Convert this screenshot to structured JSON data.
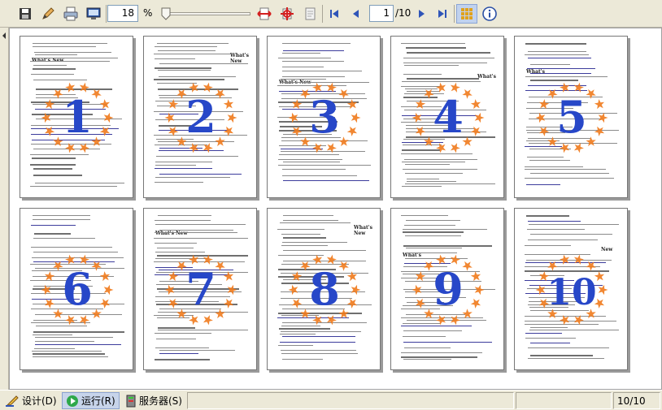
{
  "toolbar": {
    "zoom_value": "18",
    "zoom_unit": "%",
    "page_value": "1",
    "page_total": "/10",
    "icons": [
      "save-icon",
      "edit-icon",
      "print-icon",
      "page-setup-icon",
      "zoom-slider",
      "fit-width-icon",
      "fit-page-icon",
      "page-icon",
      "first-page-icon",
      "previous-page-icon",
      "next-page-icon",
      "last-page-icon",
      "multi-page-icon",
      "info-icon"
    ]
  },
  "pages": [
    {
      "number": "1",
      "heading": "What's New"
    },
    {
      "number": "2",
      "heading": "What's New"
    },
    {
      "number": "3",
      "heading": "What's New"
    },
    {
      "number": "4",
      "heading": "What's"
    },
    {
      "number": "5",
      "heading": "What's"
    },
    {
      "number": "6",
      "heading": ""
    },
    {
      "number": "7",
      "heading": "What's New"
    },
    {
      "number": "8",
      "heading": "What's New"
    },
    {
      "number": "9",
      "heading": "What's"
    },
    {
      "number": "10",
      "heading": "New"
    }
  ],
  "statusbar": {
    "tab_design": "设计(D)",
    "tab_run": "运行(R)",
    "tab_server": "服务器(S)",
    "page_indicator": "10/10"
  },
  "colors": {
    "watermark_number": "#2747c8",
    "watermark_star": "#f07a1c",
    "active_tab": "#c7d4ea"
  }
}
